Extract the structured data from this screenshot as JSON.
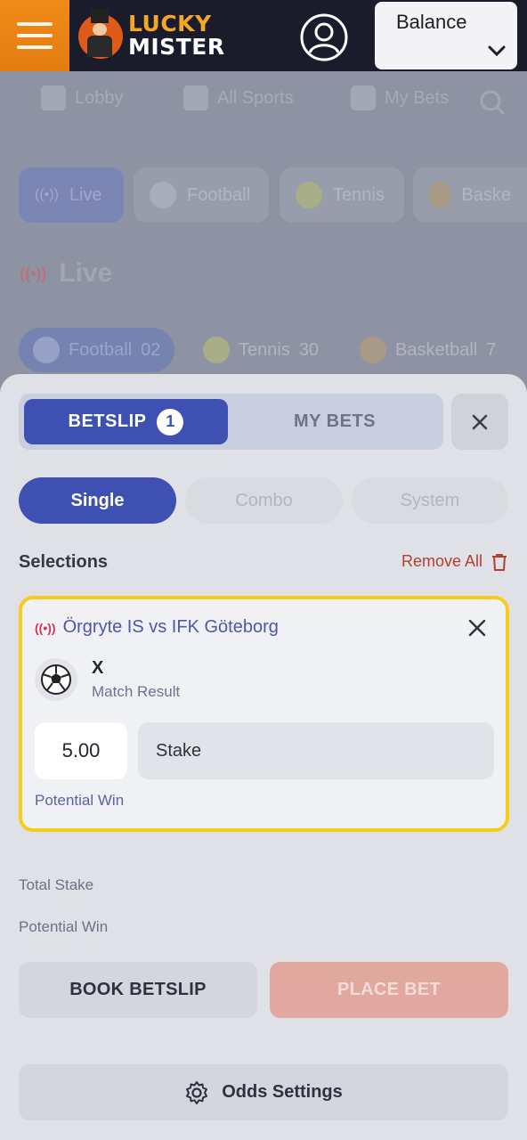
{
  "header": {
    "logo_line1": "LUCKY",
    "logo_line2": "MISTER",
    "balance_label": "Balance"
  },
  "background": {
    "nav": [
      "Lobby",
      "All Sports",
      "My Bets"
    ],
    "sports": [
      "Live",
      "Football",
      "Tennis",
      "Baske"
    ],
    "live_title": "Live",
    "live_subs": [
      {
        "label": "Football",
        "count": "02"
      },
      {
        "label": "Tennis",
        "count": "30"
      },
      {
        "label": "Basketball",
        "count": "7"
      }
    ]
  },
  "betslip": {
    "tab_betslip": "BETSLIP",
    "tab_count": "1",
    "tab_mybets": "MY BETS",
    "types": [
      "Single",
      "Combo",
      "System"
    ],
    "selections_title": "Selections",
    "remove_all": "Remove All",
    "selection": {
      "match": "Örgryte IS vs IFK Göteborg",
      "pick": "X",
      "market": "Match Result",
      "odds": "5.00",
      "stake_placeholder": "Stake",
      "potential_win": "Potential Win"
    },
    "total_stake": "Total Stake",
    "potential_win": "Potential Win",
    "book_button": "BOOK BETSLIP",
    "place_button": "PLACE BET",
    "odds_settings": "Odds Settings"
  },
  "colors": {
    "accent": "#3e51b3",
    "highlight": "#f7cd1c",
    "danger": "#b1412c",
    "brand_orange": "#f08a18"
  }
}
